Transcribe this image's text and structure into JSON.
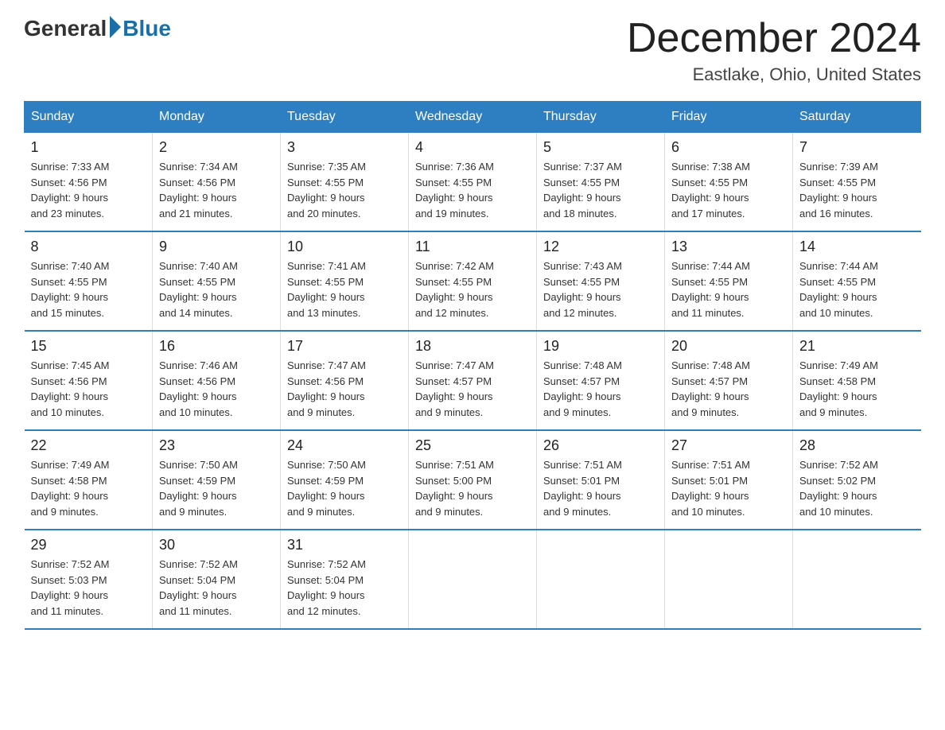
{
  "logo": {
    "general": "General",
    "blue": "Blue"
  },
  "header": {
    "month": "December 2024",
    "location": "Eastlake, Ohio, United States"
  },
  "days_of_week": [
    "Sunday",
    "Monday",
    "Tuesday",
    "Wednesday",
    "Thursday",
    "Friday",
    "Saturday"
  ],
  "weeks": [
    [
      {
        "day": "1",
        "sunrise": "7:33 AM",
        "sunset": "4:56 PM",
        "daylight": "9 hours and 23 minutes."
      },
      {
        "day": "2",
        "sunrise": "7:34 AM",
        "sunset": "4:56 PM",
        "daylight": "9 hours and 21 minutes."
      },
      {
        "day": "3",
        "sunrise": "7:35 AM",
        "sunset": "4:55 PM",
        "daylight": "9 hours and 20 minutes."
      },
      {
        "day": "4",
        "sunrise": "7:36 AM",
        "sunset": "4:55 PM",
        "daylight": "9 hours and 19 minutes."
      },
      {
        "day": "5",
        "sunrise": "7:37 AM",
        "sunset": "4:55 PM",
        "daylight": "9 hours and 18 minutes."
      },
      {
        "day": "6",
        "sunrise": "7:38 AM",
        "sunset": "4:55 PM",
        "daylight": "9 hours and 17 minutes."
      },
      {
        "day": "7",
        "sunrise": "7:39 AM",
        "sunset": "4:55 PM",
        "daylight": "9 hours and 16 minutes."
      }
    ],
    [
      {
        "day": "8",
        "sunrise": "7:40 AM",
        "sunset": "4:55 PM",
        "daylight": "9 hours and 15 minutes."
      },
      {
        "day": "9",
        "sunrise": "7:40 AM",
        "sunset": "4:55 PM",
        "daylight": "9 hours and 14 minutes."
      },
      {
        "day": "10",
        "sunrise": "7:41 AM",
        "sunset": "4:55 PM",
        "daylight": "9 hours and 13 minutes."
      },
      {
        "day": "11",
        "sunrise": "7:42 AM",
        "sunset": "4:55 PM",
        "daylight": "9 hours and 12 minutes."
      },
      {
        "day": "12",
        "sunrise": "7:43 AM",
        "sunset": "4:55 PM",
        "daylight": "9 hours and 12 minutes."
      },
      {
        "day": "13",
        "sunrise": "7:44 AM",
        "sunset": "4:55 PM",
        "daylight": "9 hours and 11 minutes."
      },
      {
        "day": "14",
        "sunrise": "7:44 AM",
        "sunset": "4:55 PM",
        "daylight": "9 hours and 10 minutes."
      }
    ],
    [
      {
        "day": "15",
        "sunrise": "7:45 AM",
        "sunset": "4:56 PM",
        "daylight": "9 hours and 10 minutes."
      },
      {
        "day": "16",
        "sunrise": "7:46 AM",
        "sunset": "4:56 PM",
        "daylight": "9 hours and 10 minutes."
      },
      {
        "day": "17",
        "sunrise": "7:47 AM",
        "sunset": "4:56 PM",
        "daylight": "9 hours and 9 minutes."
      },
      {
        "day": "18",
        "sunrise": "7:47 AM",
        "sunset": "4:57 PM",
        "daylight": "9 hours and 9 minutes."
      },
      {
        "day": "19",
        "sunrise": "7:48 AM",
        "sunset": "4:57 PM",
        "daylight": "9 hours and 9 minutes."
      },
      {
        "day": "20",
        "sunrise": "7:48 AM",
        "sunset": "4:57 PM",
        "daylight": "9 hours and 9 minutes."
      },
      {
        "day": "21",
        "sunrise": "7:49 AM",
        "sunset": "4:58 PM",
        "daylight": "9 hours and 9 minutes."
      }
    ],
    [
      {
        "day": "22",
        "sunrise": "7:49 AM",
        "sunset": "4:58 PM",
        "daylight": "9 hours and 9 minutes."
      },
      {
        "day": "23",
        "sunrise": "7:50 AM",
        "sunset": "4:59 PM",
        "daylight": "9 hours and 9 minutes."
      },
      {
        "day": "24",
        "sunrise": "7:50 AM",
        "sunset": "4:59 PM",
        "daylight": "9 hours and 9 minutes."
      },
      {
        "day": "25",
        "sunrise": "7:51 AM",
        "sunset": "5:00 PM",
        "daylight": "9 hours and 9 minutes."
      },
      {
        "day": "26",
        "sunrise": "7:51 AM",
        "sunset": "5:01 PM",
        "daylight": "9 hours and 9 minutes."
      },
      {
        "day": "27",
        "sunrise": "7:51 AM",
        "sunset": "5:01 PM",
        "daylight": "9 hours and 10 minutes."
      },
      {
        "day": "28",
        "sunrise": "7:52 AM",
        "sunset": "5:02 PM",
        "daylight": "9 hours and 10 minutes."
      }
    ],
    [
      {
        "day": "29",
        "sunrise": "7:52 AM",
        "sunset": "5:03 PM",
        "daylight": "9 hours and 11 minutes."
      },
      {
        "day": "30",
        "sunrise": "7:52 AM",
        "sunset": "5:04 PM",
        "daylight": "9 hours and 11 minutes."
      },
      {
        "day": "31",
        "sunrise": "7:52 AM",
        "sunset": "5:04 PM",
        "daylight": "9 hours and 12 minutes."
      },
      null,
      null,
      null,
      null
    ]
  ],
  "labels": {
    "sunrise": "Sunrise:",
    "sunset": "Sunset:",
    "daylight": "Daylight:"
  }
}
